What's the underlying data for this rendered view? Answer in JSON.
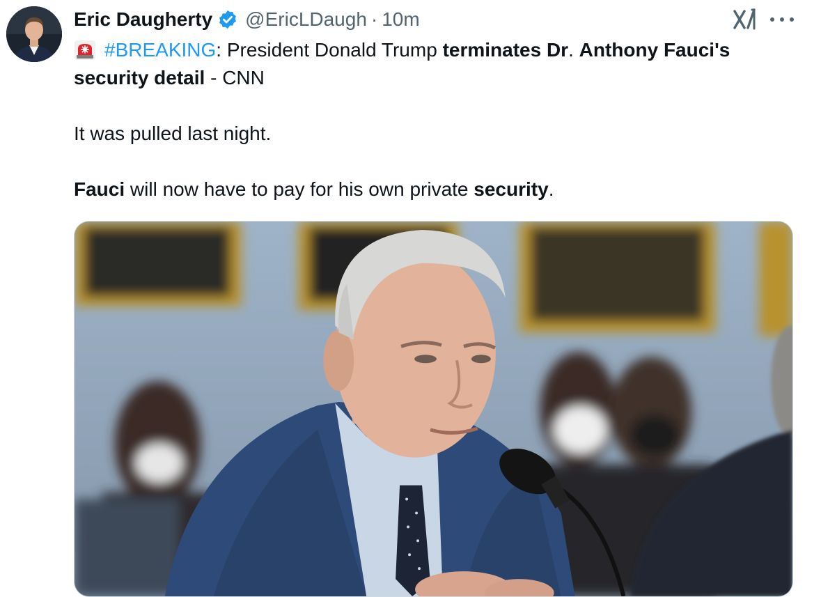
{
  "tweet": {
    "author_name": "Eric Daugherty",
    "handle": "@EricLDaugh",
    "separator": "·",
    "time": "10m",
    "verified_icon": "verified-badge-icon",
    "grok_icon": "grok-icon",
    "more_icon": "more-options-icon",
    "line1": {
      "emoji": "rotating-light-icon",
      "hashtag": "#BREAKING",
      "text_a": ": President Donald Trump ",
      "bold_a": "terminates Dr",
      "text_b": ". ",
      "bold_b": "Anthony Fauci's security detail",
      "text_c": " - CNN"
    },
    "line2": "It was pulled last night.",
    "line3": {
      "bold_a": "Fauci",
      "text_a": " will now have to pay for his own private ",
      "bold_b": "security",
      "text_b": "."
    },
    "media_description_icon": "photo-icon"
  },
  "colors": {
    "link": "#1d9bf0",
    "secondary_text": "#536471",
    "primary_text": "#0f1419",
    "verified": "#1d9bf0"
  }
}
